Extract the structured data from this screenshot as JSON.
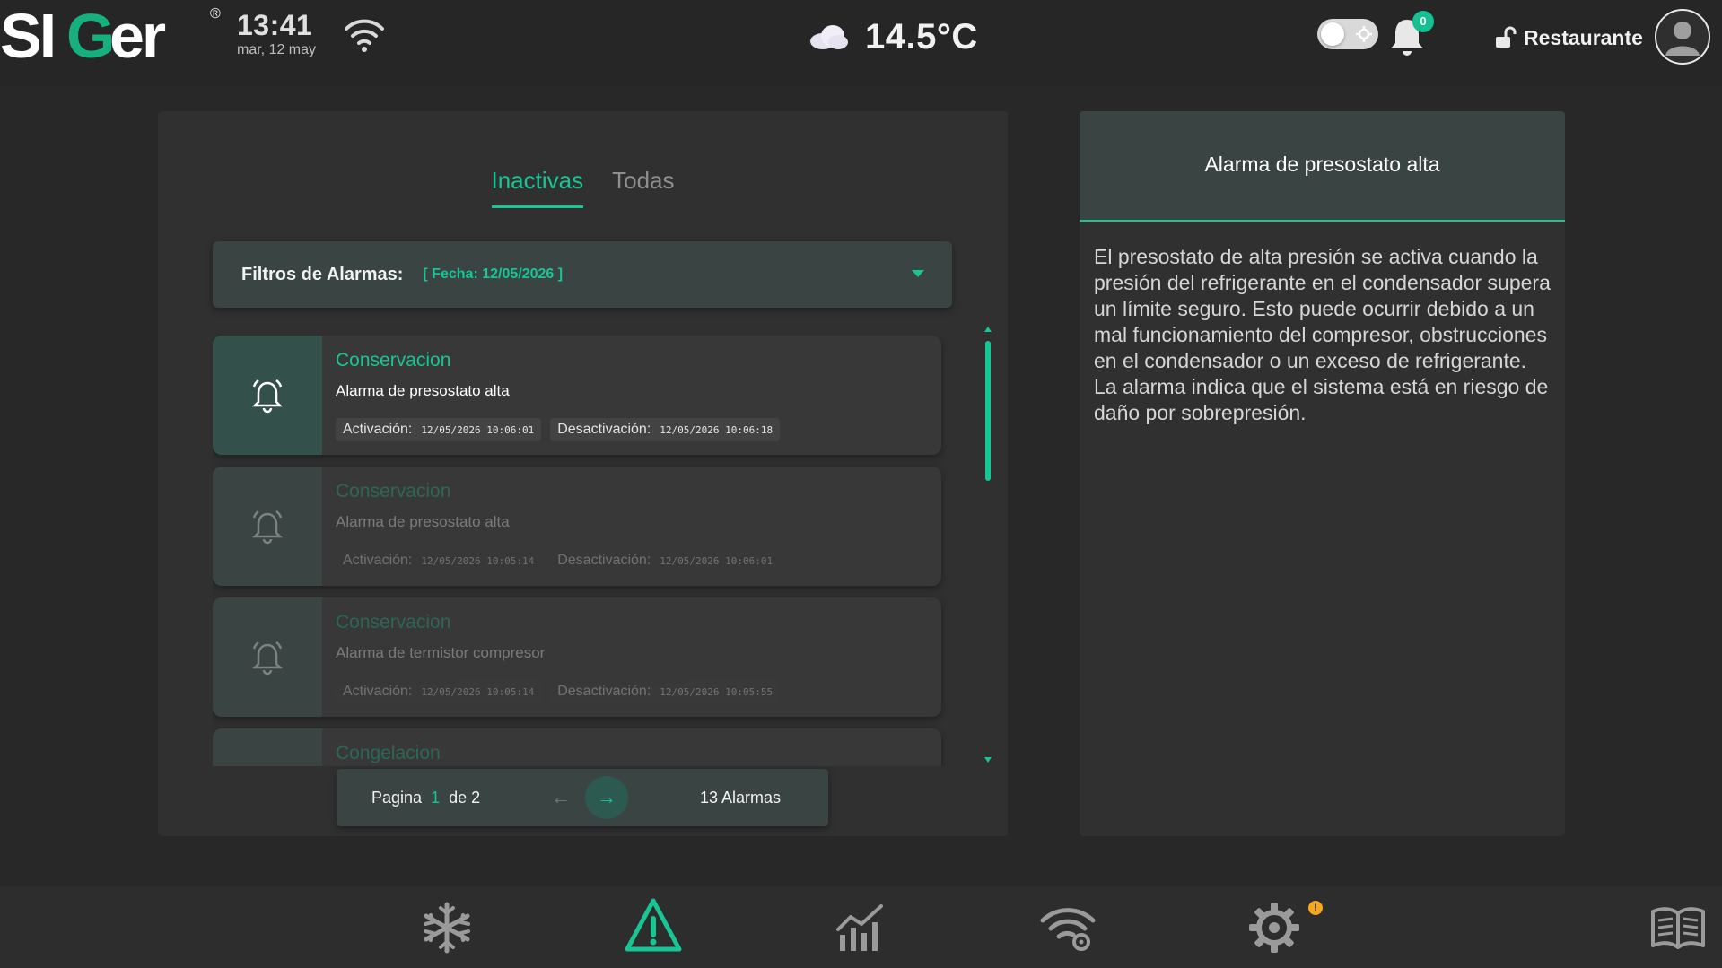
{
  "header": {
    "logo_text": "SIGer",
    "logo_registered": "®",
    "time": "13:41",
    "date": "mar, 12 may",
    "temperature": "14.5°C",
    "weather_icon": "cloud-icon",
    "notifications_count": "0",
    "user_name": "Restaurante"
  },
  "tabs": {
    "inactive_label": "Inactivas",
    "all_label": "Todas"
  },
  "filter": {
    "label": "Filtros de Alarmas:",
    "value": "[ Fecha: 12/05/2026 ]"
  },
  "alarms": [
    {
      "zone": "Conservacion",
      "description": "Alarma de presostato alta",
      "activation_label": "Activación:",
      "activation": "12/05/2026 10:06:01",
      "deactivation_label": "Desactivación:",
      "deactivation": "12/05/2026 10:06:18"
    },
    {
      "zone": "Conservacion",
      "description": "Alarma de presostato alta",
      "activation_label": "Activación:",
      "activation": "12/05/2026 10:05:14",
      "deactivation_label": "Desactivación:",
      "deactivation": "12/05/2026 10:06:01"
    },
    {
      "zone": "Conservacion",
      "description": "Alarma de termistor compresor",
      "activation_label": "Activación:",
      "activation": "12/05/2026 10:05:14",
      "deactivation_label": "Desactivación:",
      "deactivation": "12/05/2026 10:05:55"
    },
    {
      "zone": "Congelacion",
      "description": "",
      "activation_label": "",
      "activation": "",
      "deactivation_label": "",
      "deactivation": ""
    }
  ],
  "pagination": {
    "page_label": "Pagina",
    "current_page": "1",
    "of_label": "de 2",
    "prev_arrow": "←",
    "next_arrow": "→",
    "total": "13 Alarmas"
  },
  "detail": {
    "title": "Alarma de presostato alta",
    "body": "El presostato de alta presión se activa cuando la presión del refrigerante en el condensador supera un límite seguro. Esto puede ocurrir debido a un mal funcionamiento del compresor, obstrucciones en el condensador o un exceso de refrigerante. La alarma indica que el sistema está en riesgo de daño por sobrepresión."
  },
  "bottom_nav": {
    "items": [
      "snowflake-icon",
      "alarm-warning-icon",
      "chart-icon",
      "wifi-gear-icon",
      "settings-icon",
      "manual-book-icon"
    ],
    "settings_badge": "!"
  },
  "colors": {
    "accent": "#17c595",
    "background": "#282828",
    "panel": "#303030",
    "card_header": "#3a4442",
    "badge_warning": "#f5a623"
  }
}
